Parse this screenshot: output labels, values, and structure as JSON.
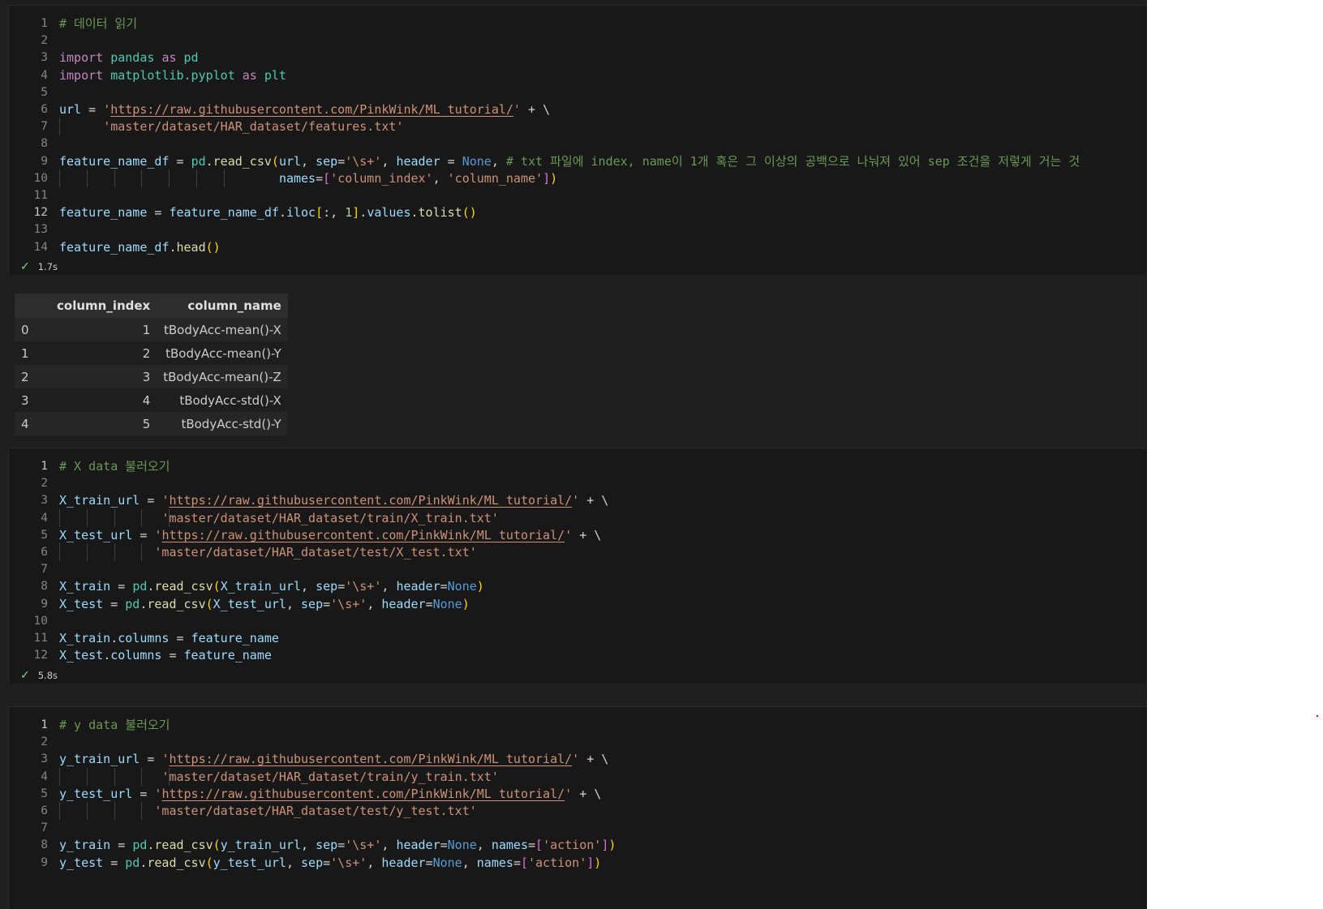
{
  "cells": [
    {
      "id": "cell1",
      "status_time": "1.7s",
      "active_line": 12,
      "lines": [
        {
          "n": "1",
          "tokens": [
            [
              "com",
              "# 데이터 읽기"
            ]
          ]
        },
        {
          "n": "2",
          "tokens": []
        },
        {
          "n": "3",
          "tokens": [
            [
              "kw",
              "import"
            ],
            [
              "op",
              " "
            ],
            [
              "mod",
              "pandas"
            ],
            [
              "op",
              " "
            ],
            [
              "kw",
              "as"
            ],
            [
              "op",
              " "
            ],
            [
              "mod",
              "pd"
            ]
          ]
        },
        {
          "n": "4",
          "tokens": [
            [
              "kw",
              "import"
            ],
            [
              "op",
              " "
            ],
            [
              "mod",
              "matplotlib.pyplot"
            ],
            [
              "op",
              " "
            ],
            [
              "kw",
              "as"
            ],
            [
              "op",
              " "
            ],
            [
              "mod",
              "plt"
            ]
          ]
        },
        {
          "n": "5",
          "tokens": []
        },
        {
          "n": "6",
          "tokens": [
            [
              "var",
              "url"
            ],
            [
              "op",
              " = "
            ],
            [
              "str",
              "'"
            ],
            [
              "url",
              "https://raw.githubusercontent.com/PinkWink/ML_tutorial/"
            ],
            [
              "str",
              "'"
            ],
            [
              "op",
              " + \\"
            ]
          ]
        },
        {
          "n": "7",
          "guides": 1,
          "indent": "      ",
          "tokens": [
            [
              "str",
              "'master/dataset/HAR_dataset/features.txt'"
            ]
          ]
        },
        {
          "n": "8",
          "tokens": []
        },
        {
          "n": "9",
          "tokens": [
            [
              "var",
              "feature_name_df"
            ],
            [
              "op",
              " = "
            ],
            [
              "mod",
              "pd"
            ],
            [
              "op",
              "."
            ],
            [
              "fn",
              "read_csv"
            ],
            [
              "br1",
              "("
            ],
            [
              "var",
              "url"
            ],
            [
              "op",
              ", "
            ],
            [
              "var",
              "sep"
            ],
            [
              "op",
              "="
            ],
            [
              "str",
              "'\\s+'"
            ],
            [
              "op",
              ", "
            ],
            [
              "var",
              "header"
            ],
            [
              "op",
              " = "
            ],
            [
              "cnst",
              "None"
            ],
            [
              "op",
              ", "
            ],
            [
              "com",
              "# txt 파일에 index, name이 1개 혹은 그 이상의 공백으로 나눠져 있어 sep 조건을 저렇게 거는 것"
            ]
          ]
        },
        {
          "n": "10",
          "guides": 7,
          "indent": "                              ",
          "tokens": [
            [
              "var",
              "names"
            ],
            [
              "op",
              "="
            ],
            [
              "br2",
              "["
            ],
            [
              "str",
              "'column_index'"
            ],
            [
              "op",
              ", "
            ],
            [
              "str",
              "'column_name'"
            ],
            [
              "br2",
              "]"
            ],
            [
              "br1",
              ")"
            ]
          ]
        },
        {
          "n": "11",
          "tokens": []
        },
        {
          "n": "12",
          "tokens": [
            [
              "var",
              "feature_name"
            ],
            [
              "op",
              " = "
            ],
            [
              "var",
              "feature_name_df"
            ],
            [
              "op",
              "."
            ],
            [
              "var",
              "iloc"
            ],
            [
              "br1",
              "["
            ],
            [
              "op",
              ":, "
            ],
            [
              "num",
              "1"
            ],
            [
              "br1",
              "]"
            ],
            [
              "op",
              "."
            ],
            [
              "var",
              "values"
            ],
            [
              "op",
              "."
            ],
            [
              "fn",
              "tolist"
            ],
            [
              "br1",
              "()"
            ]
          ]
        },
        {
          "n": "13",
          "tokens": []
        },
        {
          "n": "14",
          "tokens": [
            [
              "var",
              "feature_name_df"
            ],
            [
              "op",
              "."
            ],
            [
              "fn",
              "head"
            ],
            [
              "br1",
              "()"
            ]
          ]
        }
      ]
    },
    {
      "id": "cell2",
      "status_time": "5.8s",
      "active_line": 1,
      "lines": [
        {
          "n": "1",
          "tokens": [
            [
              "com",
              "# X data 불러오기"
            ]
          ]
        },
        {
          "n": "2",
          "tokens": []
        },
        {
          "n": "3",
          "tokens": [
            [
              "var",
              "X_train_url"
            ],
            [
              "op",
              " = "
            ],
            [
              "str",
              "'"
            ],
            [
              "url",
              "https://raw.githubusercontent.com/PinkWink/ML_tutorial/"
            ],
            [
              "str",
              "'"
            ],
            [
              "op",
              " + \\"
            ]
          ]
        },
        {
          "n": "4",
          "guides": 5,
          "indent": "              ",
          "tokens": [
            [
              "str",
              "'master/dataset/HAR_dataset/train/X_train.txt'"
            ]
          ]
        },
        {
          "n": "5",
          "tokens": [
            [
              "var",
              "X_test_url"
            ],
            [
              "op",
              " = "
            ],
            [
              "str",
              "'"
            ],
            [
              "url",
              "https://raw.githubusercontent.com/PinkWink/ML_tutorial/"
            ],
            [
              "str",
              "'"
            ],
            [
              "op",
              " + \\"
            ]
          ]
        },
        {
          "n": "6",
          "guides": 4,
          "indent": "             ",
          "tokens": [
            [
              "str",
              "'master/dataset/HAR_dataset/test/X_test.txt'"
            ]
          ]
        },
        {
          "n": "7",
          "tokens": []
        },
        {
          "n": "8",
          "tokens": [
            [
              "var",
              "X_train"
            ],
            [
              "op",
              " = "
            ],
            [
              "mod",
              "pd"
            ],
            [
              "op",
              "."
            ],
            [
              "fn",
              "read_csv"
            ],
            [
              "br1",
              "("
            ],
            [
              "var",
              "X_train_url"
            ],
            [
              "op",
              ", "
            ],
            [
              "var",
              "sep"
            ],
            [
              "op",
              "="
            ],
            [
              "str",
              "'\\s+'"
            ],
            [
              "op",
              ", "
            ],
            [
              "var",
              "header"
            ],
            [
              "op",
              "="
            ],
            [
              "cnst",
              "None"
            ],
            [
              "br1",
              ")"
            ]
          ]
        },
        {
          "n": "9",
          "tokens": [
            [
              "var",
              "X_test"
            ],
            [
              "op",
              " = "
            ],
            [
              "mod",
              "pd"
            ],
            [
              "op",
              "."
            ],
            [
              "fn",
              "read_csv"
            ],
            [
              "br1",
              "("
            ],
            [
              "var",
              "X_test_url"
            ],
            [
              "op",
              ", "
            ],
            [
              "var",
              "sep"
            ],
            [
              "op",
              "="
            ],
            [
              "str",
              "'\\s+'"
            ],
            [
              "op",
              ", "
            ],
            [
              "var",
              "header"
            ],
            [
              "op",
              "="
            ],
            [
              "cnst",
              "None"
            ],
            [
              "br1",
              ")"
            ]
          ]
        },
        {
          "n": "10",
          "tokens": []
        },
        {
          "n": "11",
          "tokens": [
            [
              "var",
              "X_train"
            ],
            [
              "op",
              "."
            ],
            [
              "var",
              "columns"
            ],
            [
              "op",
              " = "
            ],
            [
              "var",
              "feature_name"
            ]
          ]
        },
        {
          "n": "12",
          "tokens": [
            [
              "var",
              "X_test"
            ],
            [
              "op",
              "."
            ],
            [
              "var",
              "columns"
            ],
            [
              "op",
              " = "
            ],
            [
              "var",
              "feature_name"
            ]
          ]
        }
      ]
    },
    {
      "id": "cell3",
      "status_time": "",
      "active_line": 1,
      "lines": [
        {
          "n": "1",
          "tokens": [
            [
              "com",
              "# y data 불러오기"
            ]
          ]
        },
        {
          "n": "2",
          "tokens": []
        },
        {
          "n": "3",
          "tokens": [
            [
              "var",
              "y_train_url"
            ],
            [
              "op",
              " = "
            ],
            [
              "str",
              "'"
            ],
            [
              "url",
              "https://raw.githubusercontent.com/PinkWink/ML_tutorial/"
            ],
            [
              "str",
              "'"
            ],
            [
              "op",
              " + \\"
            ]
          ]
        },
        {
          "n": "4",
          "guides": 5,
          "indent": "              ",
          "tokens": [
            [
              "str",
              "'master/dataset/HAR_dataset/train/y_train.txt'"
            ]
          ]
        },
        {
          "n": "5",
          "tokens": [
            [
              "var",
              "y_test_url"
            ],
            [
              "op",
              " = "
            ],
            [
              "str",
              "'"
            ],
            [
              "url",
              "https://raw.githubusercontent.com/PinkWink/ML_tutorial/"
            ],
            [
              "str",
              "'"
            ],
            [
              "op",
              " + \\"
            ]
          ]
        },
        {
          "n": "6",
          "guides": 4,
          "indent": "             ",
          "tokens": [
            [
              "str",
              "'master/dataset/HAR_dataset/test/y_test.txt'"
            ]
          ]
        },
        {
          "n": "7",
          "tokens": []
        },
        {
          "n": "8",
          "tokens": [
            [
              "var",
              "y_train"
            ],
            [
              "op",
              " = "
            ],
            [
              "mod",
              "pd"
            ],
            [
              "op",
              "."
            ],
            [
              "fn",
              "read_csv"
            ],
            [
              "br1",
              "("
            ],
            [
              "var",
              "y_train_url"
            ],
            [
              "op",
              ", "
            ],
            [
              "var",
              "sep"
            ],
            [
              "op",
              "="
            ],
            [
              "str",
              "'\\s+'"
            ],
            [
              "op",
              ", "
            ],
            [
              "var",
              "header"
            ],
            [
              "op",
              "="
            ],
            [
              "cnst",
              "None"
            ],
            [
              "op",
              ", "
            ],
            [
              "var",
              "names"
            ],
            [
              "op",
              "="
            ],
            [
              "br2",
              "["
            ],
            [
              "str",
              "'action'"
            ],
            [
              "br2",
              "]"
            ],
            [
              "br1",
              ")"
            ]
          ]
        },
        {
          "n": "9",
          "tokens": [
            [
              "var",
              "y_test"
            ],
            [
              "op",
              " = "
            ],
            [
              "mod",
              "pd"
            ],
            [
              "op",
              "."
            ],
            [
              "fn",
              "read_csv"
            ],
            [
              "br1",
              "("
            ],
            [
              "var",
              "y_test_url"
            ],
            [
              "op",
              ", "
            ],
            [
              "var",
              "sep"
            ],
            [
              "op",
              "="
            ],
            [
              "str",
              "'\\s+'"
            ],
            [
              "op",
              ", "
            ],
            [
              "var",
              "header"
            ],
            [
              "op",
              "="
            ],
            [
              "cnst",
              "None"
            ],
            [
              "op",
              ", "
            ],
            [
              "var",
              "names"
            ],
            [
              "op",
              "="
            ],
            [
              "br2",
              "["
            ],
            [
              "str",
              "'action'"
            ],
            [
              "br2",
              "]"
            ],
            [
              "br1",
              ")"
            ]
          ]
        }
      ]
    }
  ],
  "output_table": {
    "columns": [
      "",
      "column_index",
      "column_name"
    ],
    "rows": [
      [
        "0",
        "1",
        "tBodyAcc-mean()-X"
      ],
      [
        "1",
        "2",
        "tBodyAcc-mean()-Y"
      ],
      [
        "2",
        "3",
        "tBodyAcc-mean()-Z"
      ],
      [
        "3",
        "4",
        "tBodyAcc-std()-X"
      ],
      [
        "4",
        "5",
        "tBodyAcc-std()-Y"
      ]
    ]
  },
  "icons": {
    "status_check": "checkmark-icon",
    "status_check_color": "#89d185"
  }
}
